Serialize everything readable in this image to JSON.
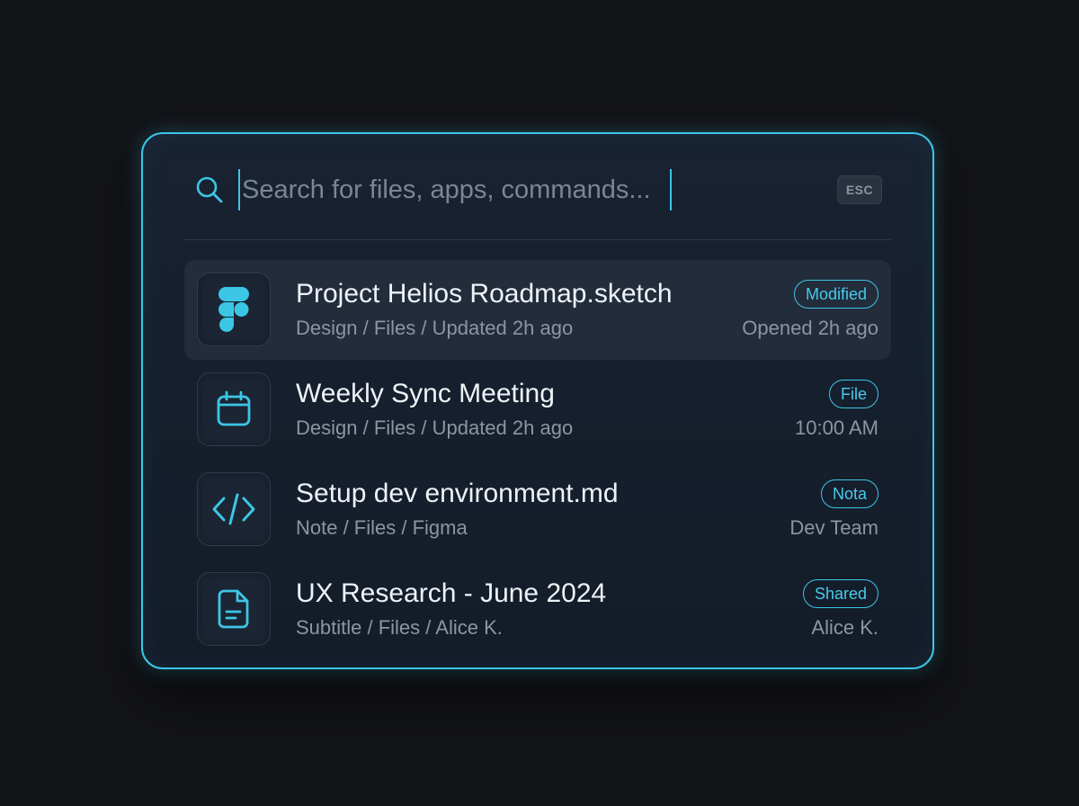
{
  "search": {
    "placeholder": "Search for files, apps, commands...",
    "value": "",
    "esc_label": "ESC"
  },
  "results": [
    {
      "icon": "figma-icon",
      "title": "Project Helios Roadmap.sketch",
      "subtitle": "Design / Files / Updated 2h ago",
      "badge": "Modified",
      "meta": "Opened 2h ago",
      "selected": true
    },
    {
      "icon": "calendar-icon",
      "title": "Weekly Sync Meeting",
      "subtitle": "Design / Files / Updated 2h ago",
      "badge": "File",
      "meta": "10:00 AM",
      "selected": false
    },
    {
      "icon": "code-icon",
      "title": "Setup dev environment.md",
      "subtitle": "Note / Files / Figma",
      "badge": "Nota",
      "meta": "Dev Team",
      "selected": false
    },
    {
      "icon": "document-icon",
      "title": "UX Research - June 2024",
      "subtitle": "Subtitle / Files / Alice K.",
      "badge": "Shared",
      "meta": "Alice K.",
      "selected": false
    }
  ],
  "colors": {
    "accent": "#3cc6e6",
    "background": "#131418",
    "panel": "#182231",
    "selected_row": "#222c3a"
  }
}
